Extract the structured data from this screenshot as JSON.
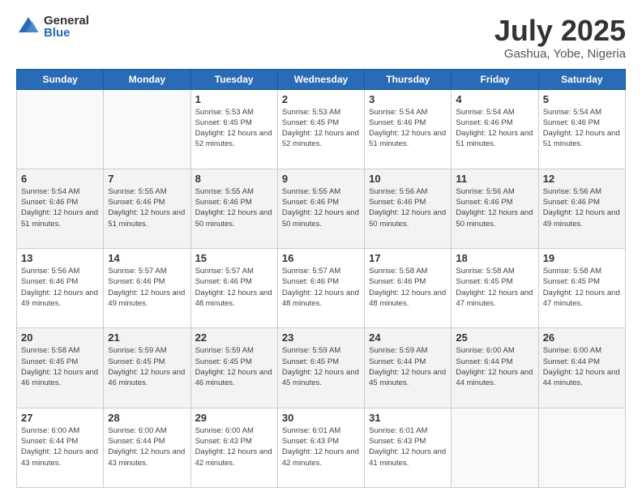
{
  "logo": {
    "general": "General",
    "blue": "Blue"
  },
  "header": {
    "month": "July 2025",
    "location": "Gashua, Yobe, Nigeria"
  },
  "weekdays": [
    "Sunday",
    "Monday",
    "Tuesday",
    "Wednesday",
    "Thursday",
    "Friday",
    "Saturday"
  ],
  "weeks": [
    [
      {
        "day": "",
        "sunrise": "",
        "sunset": "",
        "daylight": ""
      },
      {
        "day": "",
        "sunrise": "",
        "sunset": "",
        "daylight": ""
      },
      {
        "day": "1",
        "sunrise": "Sunrise: 5:53 AM",
        "sunset": "Sunset: 6:45 PM",
        "daylight": "Daylight: 12 hours and 52 minutes."
      },
      {
        "day": "2",
        "sunrise": "Sunrise: 5:53 AM",
        "sunset": "Sunset: 6:45 PM",
        "daylight": "Daylight: 12 hours and 52 minutes."
      },
      {
        "day": "3",
        "sunrise": "Sunrise: 5:54 AM",
        "sunset": "Sunset: 6:46 PM",
        "daylight": "Daylight: 12 hours and 51 minutes."
      },
      {
        "day": "4",
        "sunrise": "Sunrise: 5:54 AM",
        "sunset": "Sunset: 6:46 PM",
        "daylight": "Daylight: 12 hours and 51 minutes."
      },
      {
        "day": "5",
        "sunrise": "Sunrise: 5:54 AM",
        "sunset": "Sunset: 6:46 PM",
        "daylight": "Daylight: 12 hours and 51 minutes."
      }
    ],
    [
      {
        "day": "6",
        "sunrise": "Sunrise: 5:54 AM",
        "sunset": "Sunset: 6:46 PM",
        "daylight": "Daylight: 12 hours and 51 minutes."
      },
      {
        "day": "7",
        "sunrise": "Sunrise: 5:55 AM",
        "sunset": "Sunset: 6:46 PM",
        "daylight": "Daylight: 12 hours and 51 minutes."
      },
      {
        "day": "8",
        "sunrise": "Sunrise: 5:55 AM",
        "sunset": "Sunset: 6:46 PM",
        "daylight": "Daylight: 12 hours and 50 minutes."
      },
      {
        "day": "9",
        "sunrise": "Sunrise: 5:55 AM",
        "sunset": "Sunset: 6:46 PM",
        "daylight": "Daylight: 12 hours and 50 minutes."
      },
      {
        "day": "10",
        "sunrise": "Sunrise: 5:56 AM",
        "sunset": "Sunset: 6:46 PM",
        "daylight": "Daylight: 12 hours and 50 minutes."
      },
      {
        "day": "11",
        "sunrise": "Sunrise: 5:56 AM",
        "sunset": "Sunset: 6:46 PM",
        "daylight": "Daylight: 12 hours and 50 minutes."
      },
      {
        "day": "12",
        "sunrise": "Sunrise: 5:56 AM",
        "sunset": "Sunset: 6:46 PM",
        "daylight": "Daylight: 12 hours and 49 minutes."
      }
    ],
    [
      {
        "day": "13",
        "sunrise": "Sunrise: 5:56 AM",
        "sunset": "Sunset: 6:46 PM",
        "daylight": "Daylight: 12 hours and 49 minutes."
      },
      {
        "day": "14",
        "sunrise": "Sunrise: 5:57 AM",
        "sunset": "Sunset: 6:46 PM",
        "daylight": "Daylight: 12 hours and 49 minutes."
      },
      {
        "day": "15",
        "sunrise": "Sunrise: 5:57 AM",
        "sunset": "Sunset: 6:46 PM",
        "daylight": "Daylight: 12 hours and 48 minutes."
      },
      {
        "day": "16",
        "sunrise": "Sunrise: 5:57 AM",
        "sunset": "Sunset: 6:46 PM",
        "daylight": "Daylight: 12 hours and 48 minutes."
      },
      {
        "day": "17",
        "sunrise": "Sunrise: 5:58 AM",
        "sunset": "Sunset: 6:46 PM",
        "daylight": "Daylight: 12 hours and 48 minutes."
      },
      {
        "day": "18",
        "sunrise": "Sunrise: 5:58 AM",
        "sunset": "Sunset: 6:45 PM",
        "daylight": "Daylight: 12 hours and 47 minutes."
      },
      {
        "day": "19",
        "sunrise": "Sunrise: 5:58 AM",
        "sunset": "Sunset: 6:45 PM",
        "daylight": "Daylight: 12 hours and 47 minutes."
      }
    ],
    [
      {
        "day": "20",
        "sunrise": "Sunrise: 5:58 AM",
        "sunset": "Sunset: 6:45 PM",
        "daylight": "Daylight: 12 hours and 46 minutes."
      },
      {
        "day": "21",
        "sunrise": "Sunrise: 5:59 AM",
        "sunset": "Sunset: 6:45 PM",
        "daylight": "Daylight: 12 hours and 46 minutes."
      },
      {
        "day": "22",
        "sunrise": "Sunrise: 5:59 AM",
        "sunset": "Sunset: 6:45 PM",
        "daylight": "Daylight: 12 hours and 46 minutes."
      },
      {
        "day": "23",
        "sunrise": "Sunrise: 5:59 AM",
        "sunset": "Sunset: 6:45 PM",
        "daylight": "Daylight: 12 hours and 45 minutes."
      },
      {
        "day": "24",
        "sunrise": "Sunrise: 5:59 AM",
        "sunset": "Sunset: 6:44 PM",
        "daylight": "Daylight: 12 hours and 45 minutes."
      },
      {
        "day": "25",
        "sunrise": "Sunrise: 6:00 AM",
        "sunset": "Sunset: 6:44 PM",
        "daylight": "Daylight: 12 hours and 44 minutes."
      },
      {
        "day": "26",
        "sunrise": "Sunrise: 6:00 AM",
        "sunset": "Sunset: 6:44 PM",
        "daylight": "Daylight: 12 hours and 44 minutes."
      }
    ],
    [
      {
        "day": "27",
        "sunrise": "Sunrise: 6:00 AM",
        "sunset": "Sunset: 6:44 PM",
        "daylight": "Daylight: 12 hours and 43 minutes."
      },
      {
        "day": "28",
        "sunrise": "Sunrise: 6:00 AM",
        "sunset": "Sunset: 6:44 PM",
        "daylight": "Daylight: 12 hours and 43 minutes."
      },
      {
        "day": "29",
        "sunrise": "Sunrise: 6:00 AM",
        "sunset": "Sunset: 6:43 PM",
        "daylight": "Daylight: 12 hours and 42 minutes."
      },
      {
        "day": "30",
        "sunrise": "Sunrise: 6:01 AM",
        "sunset": "Sunset: 6:43 PM",
        "daylight": "Daylight: 12 hours and 42 minutes."
      },
      {
        "day": "31",
        "sunrise": "Sunrise: 6:01 AM",
        "sunset": "Sunset: 6:43 PM",
        "daylight": "Daylight: 12 hours and 41 minutes."
      },
      {
        "day": "",
        "sunrise": "",
        "sunset": "",
        "daylight": ""
      },
      {
        "day": "",
        "sunrise": "",
        "sunset": "",
        "daylight": ""
      }
    ]
  ]
}
